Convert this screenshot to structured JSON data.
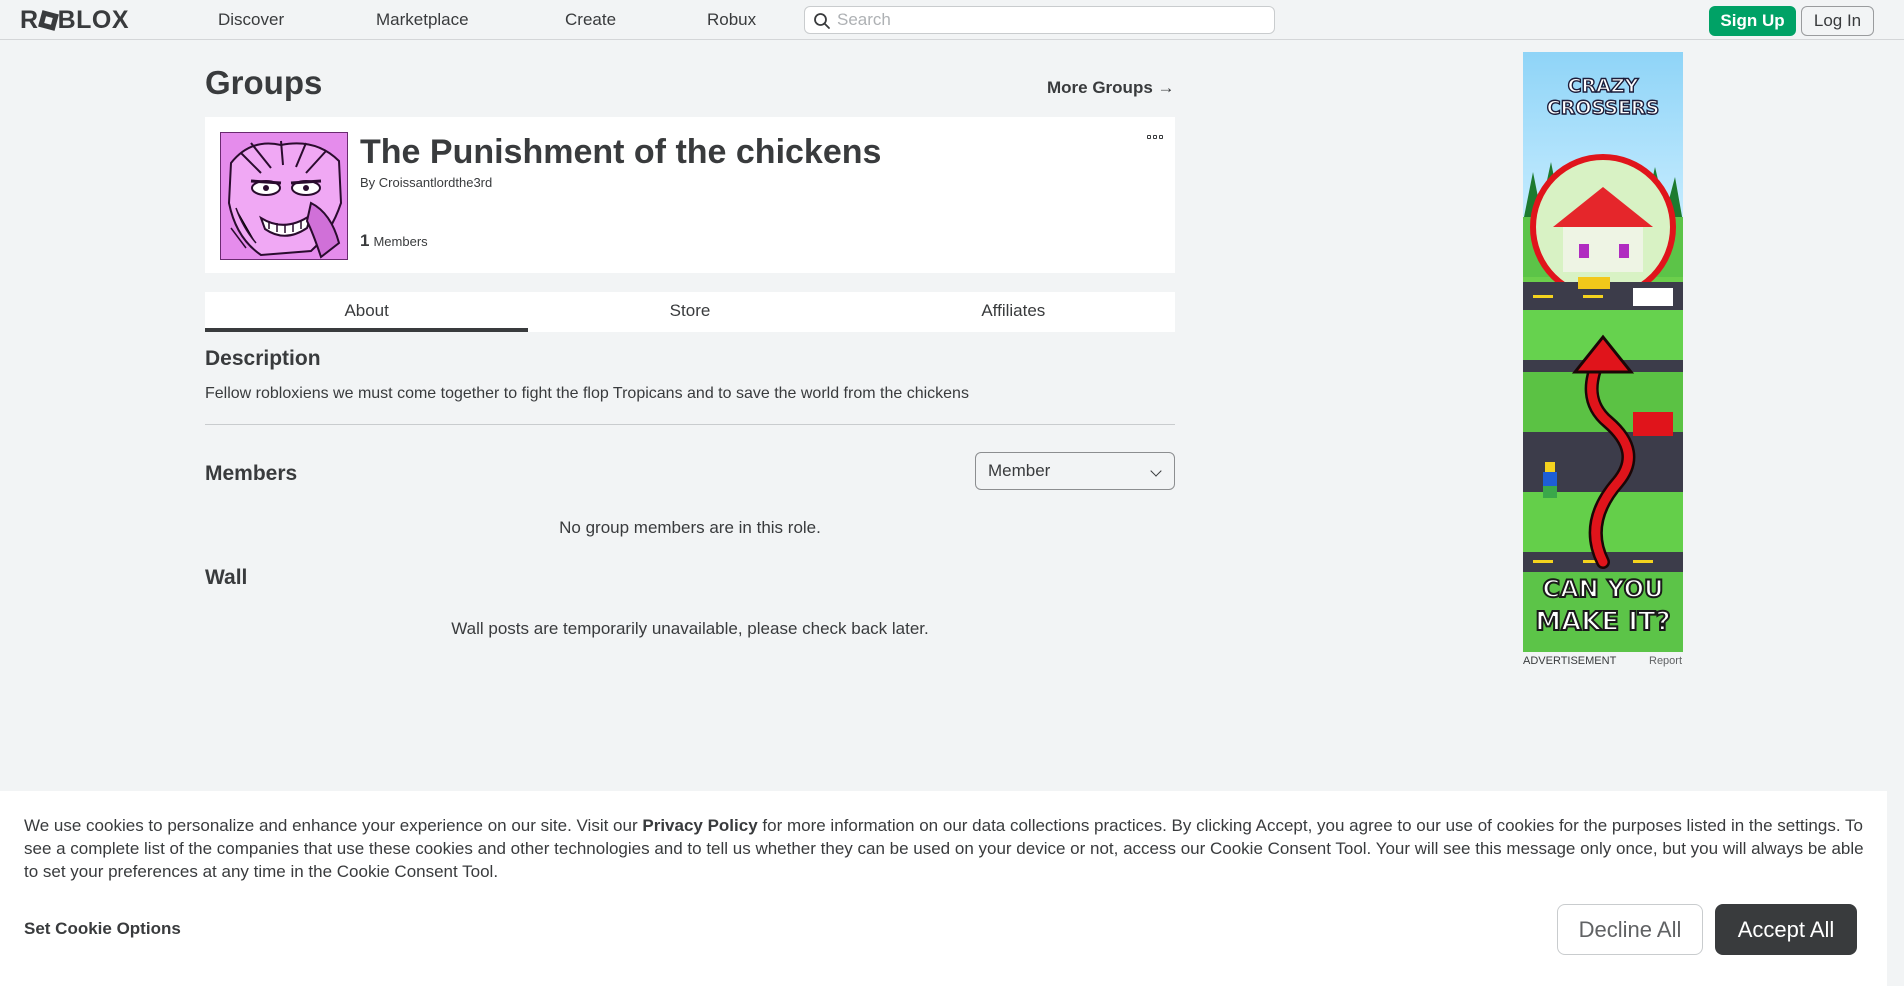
{
  "nav": {
    "logo": "ROBLOX",
    "links": [
      "Discover",
      "Marketplace",
      "Create",
      "Robux"
    ],
    "search_placeholder": "Search",
    "sign_up": "Sign Up",
    "log_in": "Log In"
  },
  "page": {
    "title": "Groups",
    "more_groups": "More Groups →"
  },
  "group": {
    "name": "The Punishment of the chickens",
    "owner_prefix": "By",
    "owner": "Croissantlordthe3rd",
    "member_count": "1",
    "member_label": "Members"
  },
  "tabs": [
    "About",
    "Store",
    "Affiliates"
  ],
  "about": {
    "description_heading": "Description",
    "description_text": "Fellow robloxiens we must come together to fight the flop Tropicans and to save the world from the chickens",
    "members_heading": "Members",
    "role_selected": "Member",
    "no_members_msg": "No group members are in this role.",
    "wall_heading": "Wall",
    "wall_msg": "Wall posts are temporarily unavailable, please check back later."
  },
  "ad": {
    "title_line1": "CRAZY",
    "title_line2": "CROSSERS",
    "tagline_line1": "CAN YOU",
    "tagline_line2": "MAKE IT?",
    "label": "ADVERTISEMENT",
    "report": "Report"
  },
  "cookie": {
    "text_before": "We use cookies to personalize and enhance your experience on our site. Visit our ",
    "policy_link": "Privacy Policy",
    "text_after": " for more information on our data collections practices. By clicking Accept, you agree to our use of cookies for the purposes listed in the settings. To see a complete list of the companies that use these cookies and other technologies and to tell us whether they can be used on your device or not, access our Cookie Consent Tool. Your will see this message only once, but you will always be able to set your preferences at any time in the Cookie Consent Tool.",
    "set_options": "Set Cookie Options",
    "decline": "Decline All",
    "accept": "Accept All"
  },
  "colors": {
    "accent_green": "#00a266",
    "text_dark": "#393b3d",
    "background": "#f2f4f5"
  }
}
